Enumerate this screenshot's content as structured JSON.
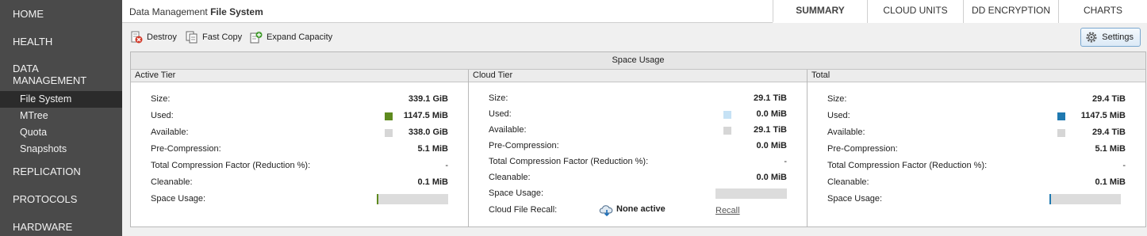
{
  "nav": {
    "home": "HOME",
    "health": "HEALTH",
    "data_management_1": "DATA",
    "data_management_2": "MANAGEMENT",
    "sub": [
      "File System",
      "MTree",
      "Quota",
      "Snapshots"
    ],
    "replication": "REPLICATION",
    "protocols": "PROTOCOLS",
    "hardware": "HARDWARE"
  },
  "breadcrumb": {
    "section": "Data Management",
    "page": "File System"
  },
  "tabs": [
    "SUMMARY",
    "CLOUD UNITS",
    "DD ENCRYPTION",
    "CHARTS"
  ],
  "toolbar": {
    "destroy": "Destroy",
    "fast_copy": "Fast Copy",
    "expand": "Expand Capacity",
    "settings": "Settings"
  },
  "panel": {
    "title": "Space Usage",
    "labels": {
      "size": "Size:",
      "used": "Used:",
      "available": "Available:",
      "pre_compression": "Pre-Compression:",
      "tcf": "Total Compression Factor (Reduction %):",
      "cleanable": "Cleanable:",
      "space_usage": "Space Usage:",
      "cloud_recall": "Cloud File Recall:"
    },
    "active": {
      "head": "Active Tier",
      "size": "339.1 GiB",
      "used": "1147.5 MiB",
      "available": "338.0 GiB",
      "pre_compression": "5.1 MiB",
      "tcf": "-",
      "cleanable": "0.1 MiB",
      "usage_fraction": 0.003,
      "used_color": "#5e8a1e",
      "avail_color": "#d6d6d6"
    },
    "cloud": {
      "head": "Cloud Tier",
      "size": "29.1 TiB",
      "used": "0.0 MiB",
      "available": "29.1 TiB",
      "pre_compression": "0.0 MiB",
      "tcf": "-",
      "cleanable": "0.0 MiB",
      "usage_fraction": 0.0,
      "used_color": "#c6e2f5",
      "avail_color": "#d6d6d6",
      "recall_status": "None active",
      "recall_link": "Recall"
    },
    "total": {
      "head": "Total",
      "size": "29.4 TiB",
      "used": "1147.5 MiB",
      "available": "29.4 TiB",
      "pre_compression": "5.1 MiB",
      "tcf": "-",
      "cleanable": "0.1 MiB",
      "usage_fraction": 0.003,
      "used_color": "#1f79b0",
      "avail_color": "#d6d6d6"
    }
  }
}
